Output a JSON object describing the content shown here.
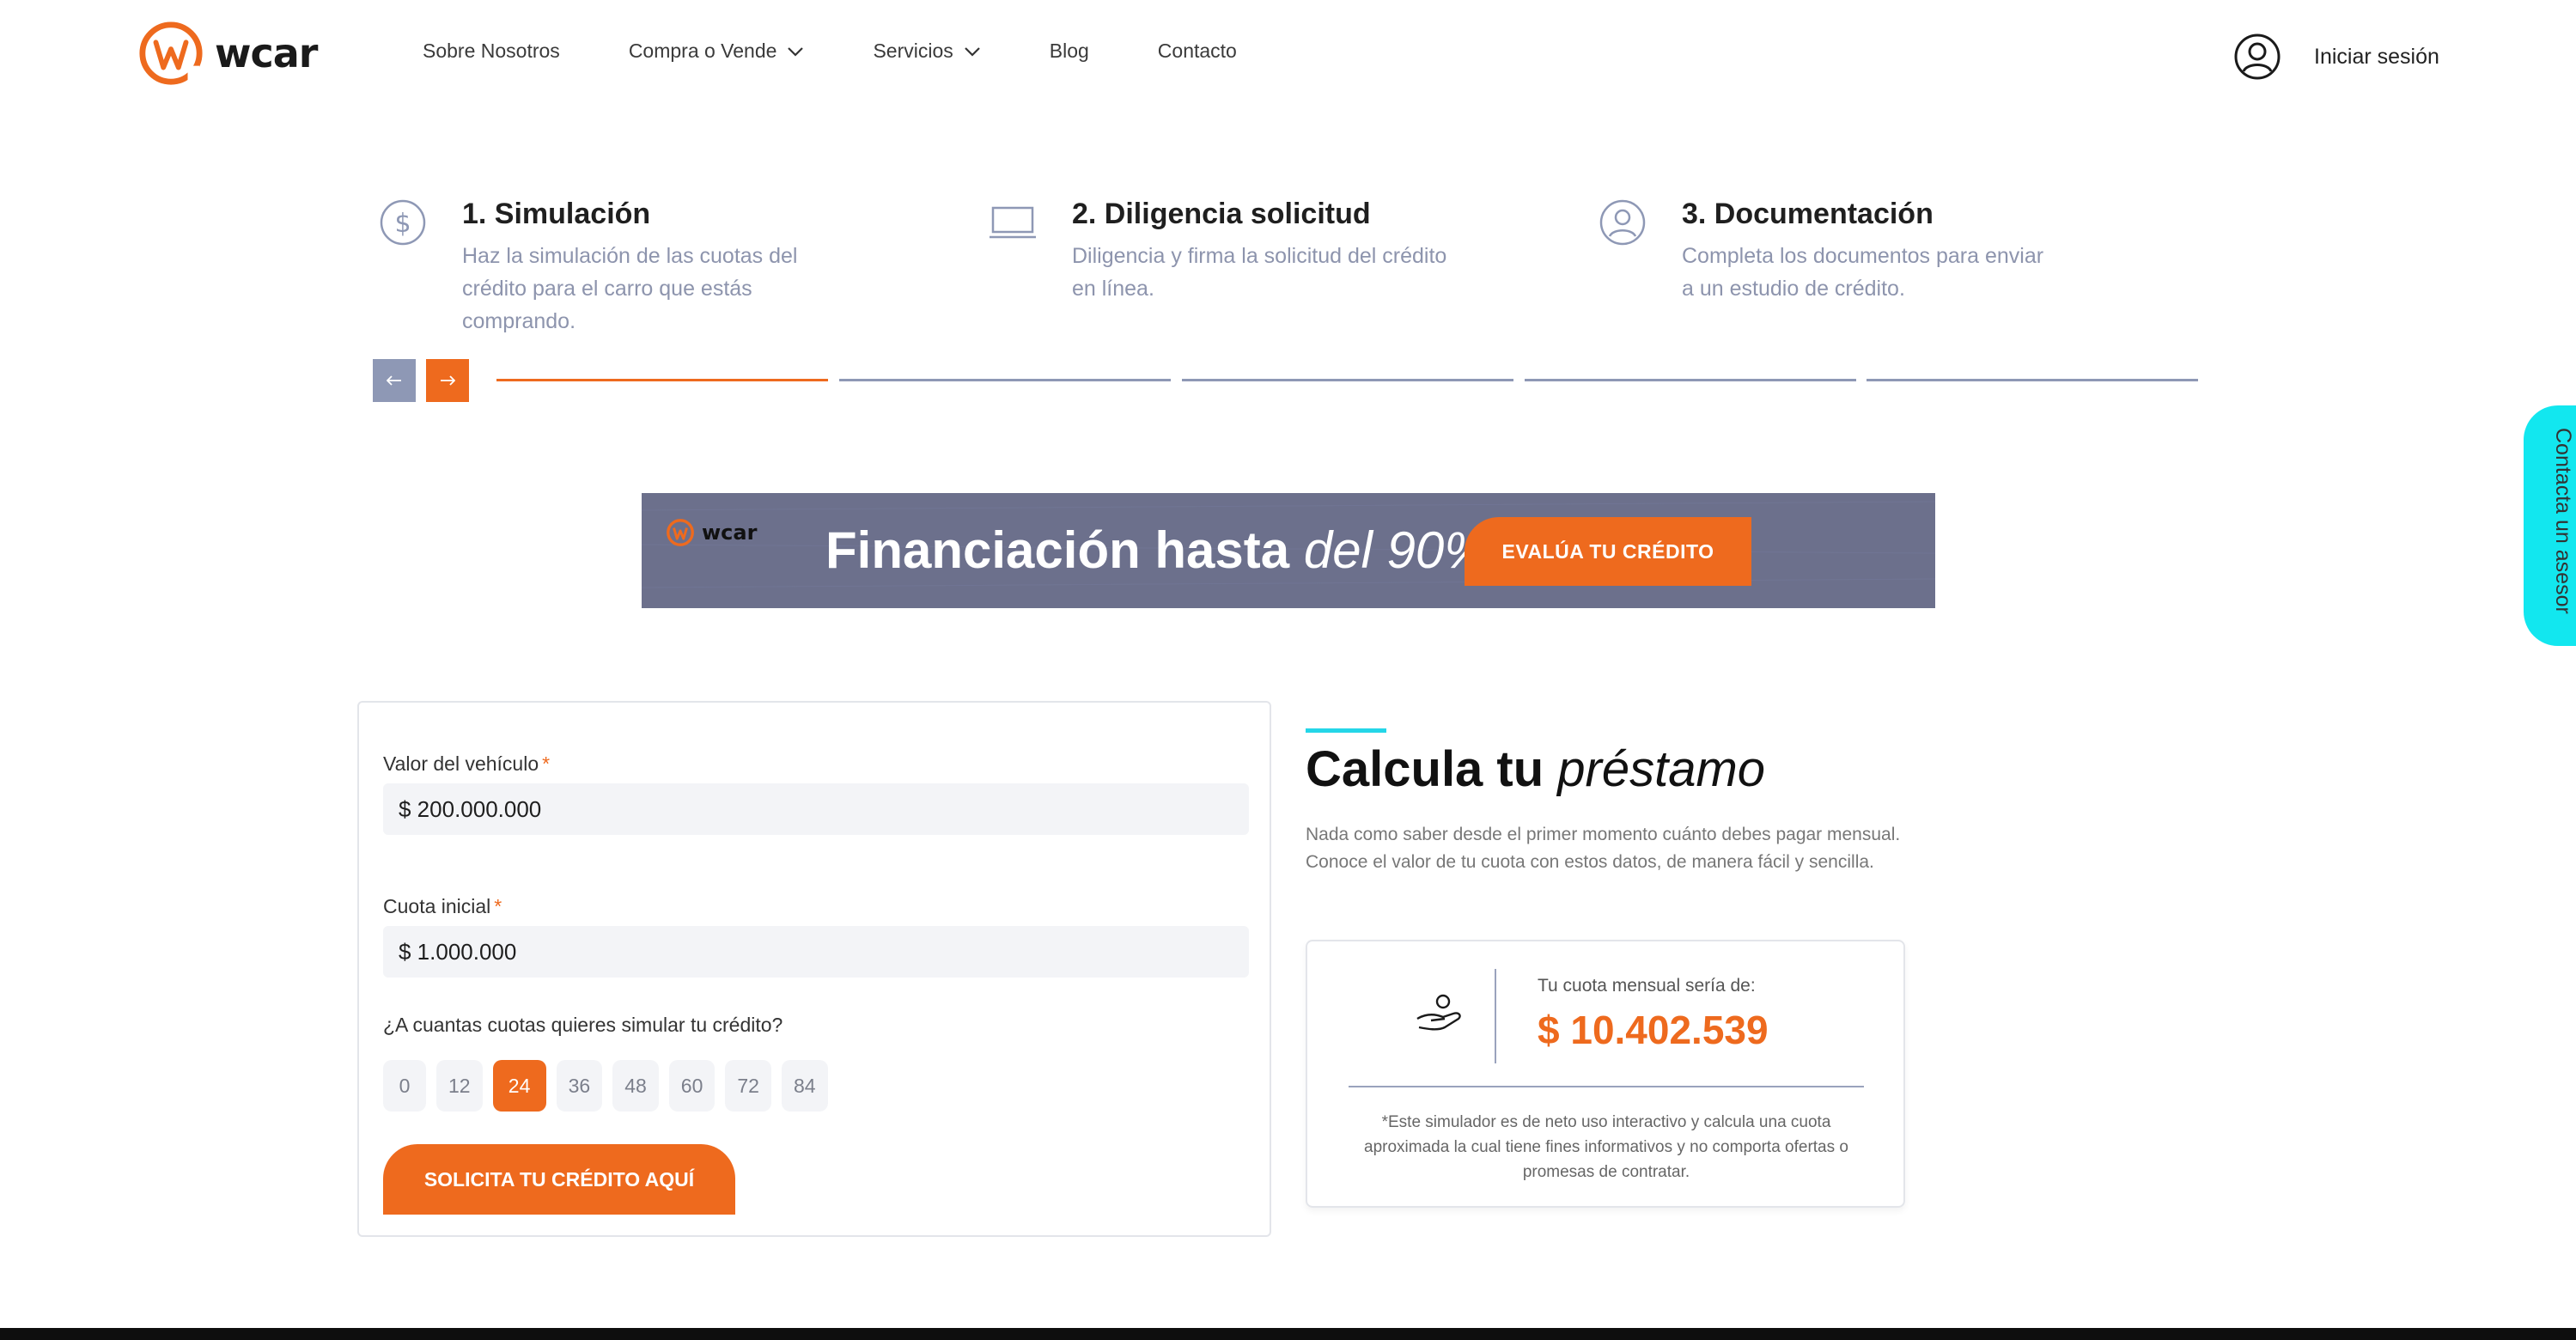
{
  "brand": {
    "name": "wcar",
    "accent": "#ee6a1e",
    "secondary": "#8e98b5",
    "cyan": "#12e7ef"
  },
  "nav": {
    "items": [
      {
        "label": "Sobre Nosotros",
        "has_dropdown": false
      },
      {
        "label": "Compra o Vende",
        "has_dropdown": true
      },
      {
        "label": "Servicios",
        "has_dropdown": true
      },
      {
        "label": "Blog",
        "has_dropdown": false
      },
      {
        "label": "Contacto",
        "has_dropdown": false
      }
    ],
    "login_label": "Iniciar sesión",
    "login_icon": "user-circle-icon"
  },
  "steps": [
    {
      "title": "1. Simulación",
      "description": "Haz la simulación de las cuotas del crédito para el carro que estás comprando.",
      "icon": "dollar-circle-icon"
    },
    {
      "title": "2. Diligencia solicitud",
      "description": "Diligencia y firma la solicitud del crédito en línea.",
      "icon": "laptop-icon"
    },
    {
      "title": "3. Documentación",
      "description": "Completa los documentos para enviar a un estudio de crédito.",
      "icon": "user-circle-icon"
    }
  ],
  "carousel": {
    "active_segment": 1,
    "segment_count": 5,
    "prev_icon": "arrow-left-icon",
    "next_icon": "arrow-right-icon"
  },
  "banner": {
    "logo_text": "wcar",
    "headline_main": "Financiación hasta",
    "headline_emphasis": "del 90%",
    "cta_label": "EVALÚA TU CRÉDITO"
  },
  "form": {
    "vehicle_label": "Valor del vehículo",
    "vehicle_value": "$ 200.000.000",
    "initial_label": "Cuota inicial",
    "initial_value": "$ 1.000.000",
    "required_mark": "*",
    "installments_question": "¿A cuantas cuotas quieres simular tu crédito?",
    "installment_options": [
      "0",
      "12",
      "24",
      "36",
      "48",
      "60",
      "72",
      "84"
    ],
    "selected_installment": "24",
    "submit_label": "SOLICITA TU CRÉDITO AQUÍ"
  },
  "calculator": {
    "title_main": "Calcula tu",
    "title_emphasis": "préstamo",
    "description": "Nada como saber desde el primer momento cuánto debes pagar mensual. Conoce el valor de tu cuota con estos datos, de manera fácil y sencilla.",
    "result_label": "Tu cuota mensual sería de:",
    "result_value": "$ 10.402.539",
    "result_icon": "hand-money-icon",
    "disclaimer": "*Este simulador es de neto uso interactivo y calcula una cuota aproximada la cual tiene fines informativos y no comporta ofertas o promesas de contratar."
  },
  "side_tab": {
    "label": "Contacta un asesor"
  }
}
